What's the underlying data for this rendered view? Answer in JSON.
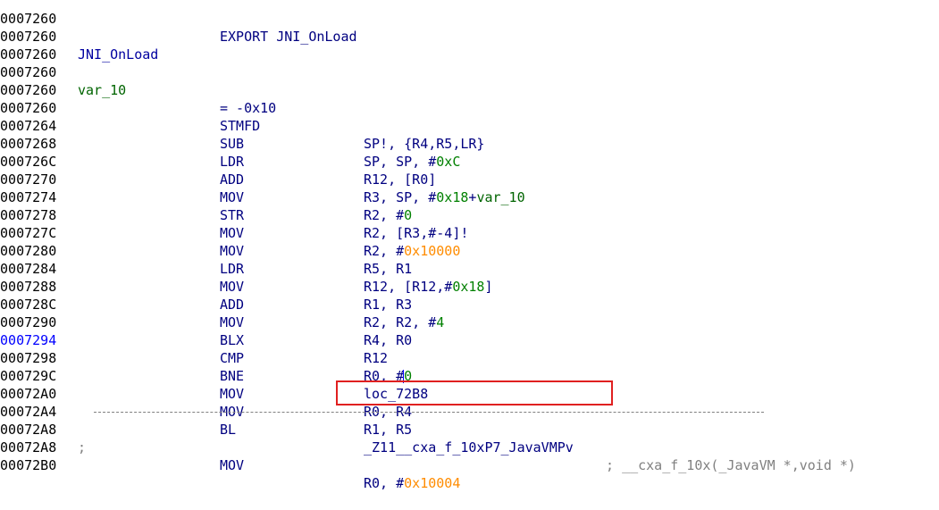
{
  "colors": {
    "background": "#ffffff",
    "address": "#000000",
    "address_current": "#0000ff",
    "code": "#000080",
    "variable": "#006400",
    "number": "#008000",
    "hex_value": "#ff8c00",
    "comment": "#808080",
    "highlight_box": "#e02020"
  },
  "listing": {
    "export_line": {
      "addr": "00007260",
      "text": "EXPORT JNI_OnLoad"
    },
    "func_label": {
      "addr": "00007260",
      "text": "JNI_OnLoad"
    },
    "blank1": {
      "addr": "00007260"
    },
    "var_def": {
      "addr": "00007260",
      "name": "var_10",
      "value": "= -0x10"
    },
    "blank2": {
      "addr": "00007260"
    },
    "instructions": [
      {
        "addr": "00007260",
        "mn": "STMFD",
        "op": "SP!, {R4,R5,LR}"
      },
      {
        "addr": "00007264",
        "mn": "SUB",
        "op_a": "SP, SP, #",
        "op_num": "0xC"
      },
      {
        "addr": "00007268",
        "mn": "LDR",
        "op": "R12, [R0]"
      },
      {
        "addr": "0000726C",
        "mn": "ADD",
        "op_a": "R3, SP, #",
        "op_num": "0x18",
        "op_b": "+",
        "op_var": "var_10"
      },
      {
        "addr": "00007270",
        "mn": "MOV",
        "op_a": "R2, #",
        "op_num": "0"
      },
      {
        "addr": "00007274",
        "mn": "STR",
        "op": "R2, [R3,#-4]!"
      },
      {
        "addr": "00007278",
        "mn": "MOV",
        "op_a": "R2, #",
        "op_hex": "0x10000"
      },
      {
        "addr": "0000727C",
        "mn": "MOV",
        "op": "R5, R1"
      },
      {
        "addr": "00007280",
        "mn": "LDR",
        "op_a": "R12, [R12,#",
        "op_num": "0x18",
        "op_b": "]"
      },
      {
        "addr": "00007284",
        "mn": "MOV",
        "op": "R1, R3"
      },
      {
        "addr": "00007288",
        "mn": "ADD",
        "op_a": "R2, R2, #",
        "op_num": "4"
      },
      {
        "addr": "0000728C",
        "mn": "MOV",
        "op": "R4, R0"
      },
      {
        "addr": "00007290",
        "mn": "BLX",
        "op": "R12"
      },
      {
        "addr": "00007294",
        "mn": "CMP",
        "op_a": "R0, #",
        "op_num": "0",
        "current": true
      },
      {
        "addr": "00007298",
        "mn": "BNE",
        "op": "loc_72B8"
      },
      {
        "addr": "0000729C",
        "mn": "MOV",
        "op": "R0, R4"
      },
      {
        "addr": "000072A0",
        "mn": "MOV",
        "op": "R1, R5"
      }
    ],
    "call_line": {
      "addr": "000072A4",
      "mn": "BL",
      "target": "_Z11__cxa_f_10xP7_JavaVMPv",
      "semicolon": ";",
      "comment": "__cxa_f_10x(_JavaVM *,void *)"
    },
    "separator": {
      "addr": "000072A8",
      "text": ";"
    },
    "after": {
      "addr": "000072A8",
      "mn": "MOV",
      "op_a": "R0, #",
      "op_hex": "0x10004"
    },
    "last": {
      "addr": "000072B0"
    }
  }
}
